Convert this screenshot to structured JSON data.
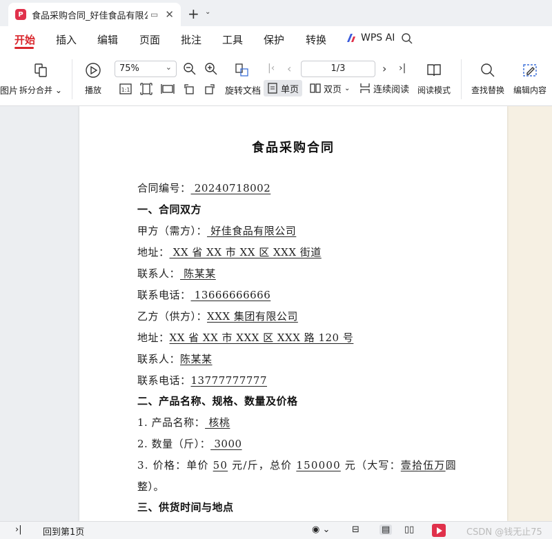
{
  "titlebar": {
    "tab_title": "食品采购合同_好佳食品有限公",
    "app_icon": "wps-pdf-icon"
  },
  "menu": {
    "items": [
      "开始",
      "插入",
      "编辑",
      "页面",
      "批注",
      "工具",
      "保护",
      "转换"
    ],
    "active": "开始",
    "ai_label": "WPS AI"
  },
  "ribbon": {
    "left_cut_label": "图片",
    "split_merge": "拆分合并",
    "play": "播放",
    "zoom": "75%",
    "rotate_doc": "旋转文档",
    "single_page": "单页",
    "double_page": "双页",
    "continuous": "连续阅读",
    "page_indicator": "1/3",
    "read_mode": "阅读模式",
    "find_replace": "查找替换",
    "edit_content": "编辑内容"
  },
  "document": {
    "title": "食品采购合同",
    "contract_no_label": "合同编号：",
    "contract_no": "  20240718002  ",
    "section1": "一、合同双方",
    "party_a_label": "甲方（需方）：",
    "party_a": "  好佳食品有限公司  ",
    "address_label": "地址：",
    "address_a": "  XX 省 XX 市 XX 区 XXX 街道  ",
    "contact_label": "联系人：",
    "contact_a": "  陈某某  ",
    "phone_label": "联系电话：",
    "phone_a": "  13666666666  ",
    "party_b_label": "乙方（供方）：",
    "party_b": "XXX 集团有限公司",
    "address_b": "XX 省 XX 市 XXX 区 XXX 路 120 号",
    "contact_b": "陈某某",
    "phone_b": "13777777777",
    "section2": "二、产品名称、规格、数量及价格",
    "item1_label": "1. 产品名称：",
    "item1_value": "  核桃  ",
    "item2_label": "2. 数量（斤）：",
    "item2_value": "  3000  ",
    "item3_a": "3. 价格：单价 ",
    "item3_price": "50",
    "item3_b": " 元/斤，总价 ",
    "item3_total": "150000",
    "item3_c": " 元（大写：",
    "item3_upper": "壹拾伍万",
    "item3_d": "圆",
    "item3_cont": "整）。",
    "section3": "三、供货时间与地点"
  },
  "statusbar": {
    "first_page": "回到第1页",
    "watermark": "CSDN @钱无止75"
  }
}
